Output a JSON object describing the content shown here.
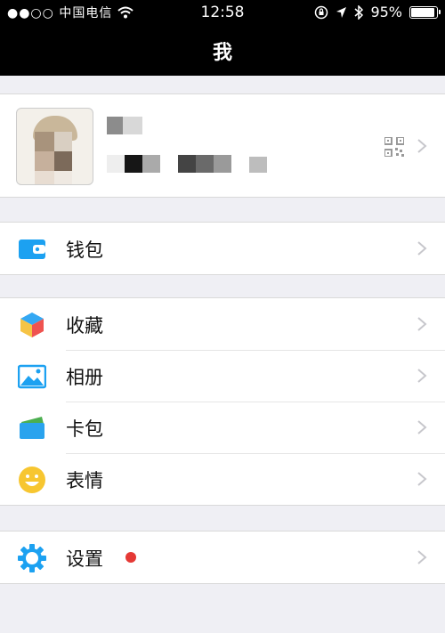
{
  "status_bar": {
    "carrier": "●●○○ 中国电信",
    "time": "12:58",
    "battery": "95%"
  },
  "nav": {
    "title": "我"
  },
  "menu": {
    "wallet": "钱包",
    "favorites": "收藏",
    "album": "相册",
    "cards": "卡包",
    "stickers": "表情",
    "settings": "设置"
  },
  "colors": {
    "accent": "#1aa1f0",
    "badge": "#e53935"
  }
}
